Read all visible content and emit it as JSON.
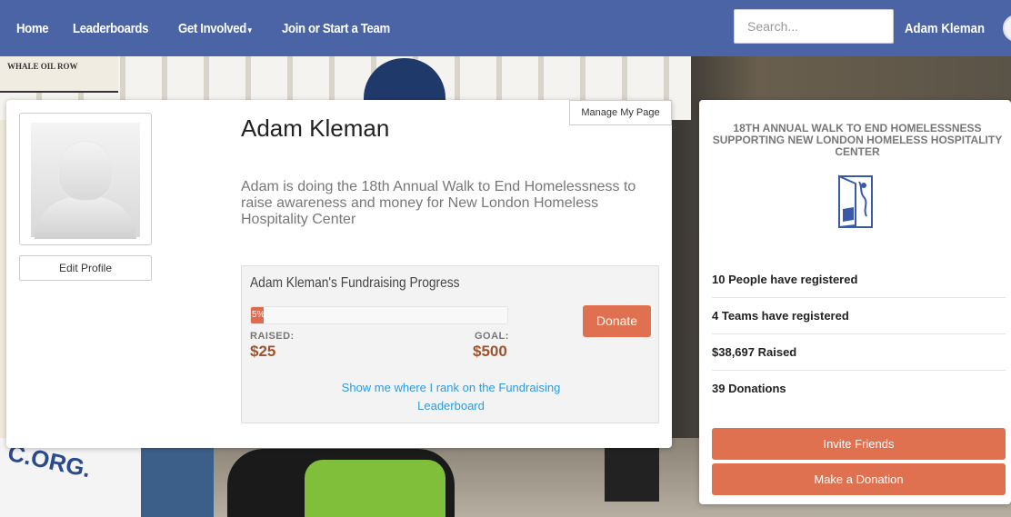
{
  "nav": {
    "items": [
      {
        "label": "Home"
      },
      {
        "label": "Leaderboards"
      },
      {
        "label": "Get Involved"
      },
      {
        "label": "Join or Start a Team"
      }
    ],
    "search_placeholder": "Search...",
    "user_name": "Adam Kleman"
  },
  "background": {
    "sign_text": "WHALE OIL ROW",
    "banner_text": "C.ORG."
  },
  "profile": {
    "manage_label": "Manage My Page",
    "edit_label": "Edit Profile",
    "name": "Adam Kleman",
    "description": "Adam is doing the 18th Annual Walk to End Homelessness to raise awareness and money for New London Homeless Hospitality Center"
  },
  "fundraising": {
    "title": "Adam Kleman's Fundraising Progress",
    "progress_percent": 5,
    "progress_label": "5%",
    "raised_label": "RAISED:",
    "raised_value": "$25",
    "goal_label": "GOAL:",
    "goal_value": "$500",
    "donate_label": "Donate",
    "rank_link": "Show me where I rank on the Fundraising Leaderboard"
  },
  "event": {
    "title": "18th Annual Walk to End Homelessness Supporting New London Homeless Hospitality Center",
    "stats": [
      {
        "text": "10 People have registered"
      },
      {
        "text": "4 Teams have registered"
      },
      {
        "text": "$38,697 Raised"
      },
      {
        "text": "39 Donations"
      }
    ],
    "invite_label": "Invite Friends",
    "donation_label": "Make a Donation"
  },
  "colors": {
    "nav_bg": "#4a64a6",
    "accent": "#e07150",
    "link": "#2d9be0",
    "amount": "#a0522d"
  }
}
